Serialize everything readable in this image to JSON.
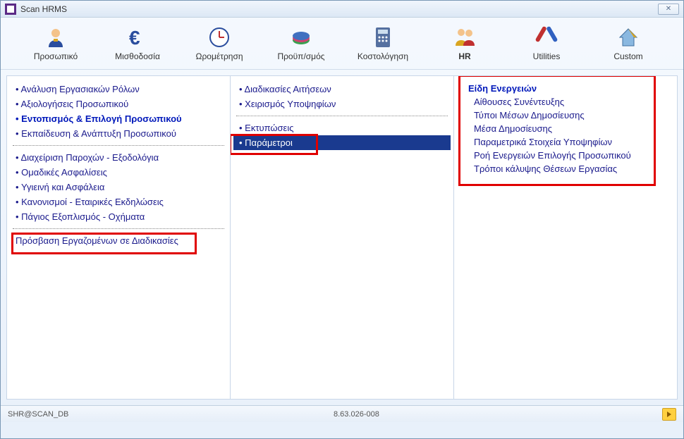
{
  "window": {
    "title": "Scan HRMS"
  },
  "toolbar": {
    "items": [
      {
        "label": "Προσωπικό"
      },
      {
        "label": "Μισθοδοσία"
      },
      {
        "label": "Ωρομέτρηση"
      },
      {
        "label": "Προϋπ/σμός"
      },
      {
        "label": "Κοστολόγηση"
      },
      {
        "label": "HR"
      },
      {
        "label": "Utilities"
      },
      {
        "label": "Custom"
      }
    ]
  },
  "leftMenu": {
    "g1": [
      "Ανάλυση Εργασιακών Ρόλων",
      "Αξιολογήσεις Προσωπικού",
      "Εντοπισμός & Επιλογή Προσωπικού",
      "Εκπαίδευση & Ανάπτυξη Προσωπικού"
    ],
    "g2": [
      "Διαχείριση Παροχών - Εξοδολόγια",
      "Ομαδικές Ασφαλίσεις",
      "Υγιεινή και Ασφάλεια",
      "Κανονισμοί - Εταιρικές Εκδηλώσεις",
      "Πάγιος Εξοπλισμός - Οχήματα"
    ],
    "g3": [
      "Πρόσβαση Εργαζομένων σε Διαδικασίες"
    ]
  },
  "middleMenu": {
    "g1": [
      "Διαδικασίες Αιτήσεων",
      "Χειρισμός Υποψηφίων"
    ],
    "g2": [
      "Εκτυπώσεις",
      "Παράμετροι"
    ]
  },
  "rightMenu": {
    "header": "Είδη Ενεργειών",
    "items": [
      "Αίθουσες Συνέντευξης",
      "Τύποι Μέσων Δημοσίευσης",
      "Μέσα Δημοσίευσης",
      "Παραμετρικά Στοιχεία Υποψηφίων",
      "Ροή Ενεργειών Επιλογής Προσωπικού",
      "Τρόποι κάλυψης Θέσεων Εργασίας"
    ]
  },
  "status": {
    "left": "SHR@SCAN_DB",
    "center": "8.63.026-008"
  }
}
